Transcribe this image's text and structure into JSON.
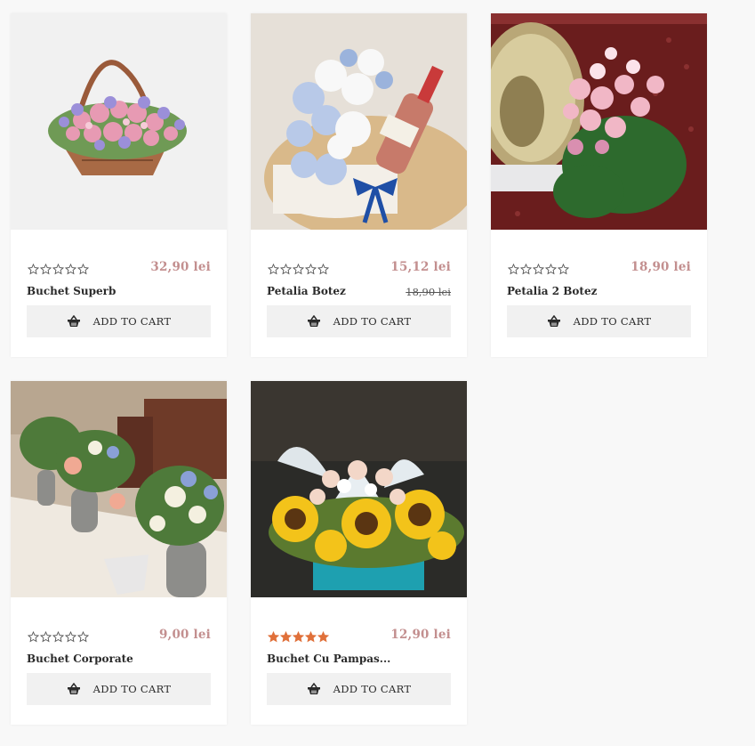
{
  "cart_label": "ADD TO CART",
  "colors": {
    "price": "#c38f8f",
    "star_empty": "#555555",
    "star_filled": "#e0703a",
    "button_bg": "#f1f1f1",
    "page_bg": "#f8f8f8"
  },
  "products": [
    {
      "name": "Buchet Superb",
      "price": "32,90 lei",
      "old_price": "",
      "rating": 0,
      "image": "pink-rose-basket"
    },
    {
      "name": "Petalia Botez",
      "price": "15,12 lei",
      "old_price": "18,90 lei",
      "rating": 0,
      "image": "box-with-bottle"
    },
    {
      "name": "Petalia 2 Botez",
      "price": "18,90 lei",
      "old_price": "",
      "rating": 0,
      "image": "pastel-bouquet-bowl"
    },
    {
      "name": "Buchet Corporate",
      "price": "9,00 lei",
      "old_price": "",
      "rating": 0,
      "image": "table-vases"
    },
    {
      "name": "Buchet Cu Pampas...",
      "price": "12,90 lei",
      "old_price": "",
      "rating": 5,
      "image": "sunflower-box"
    }
  ]
}
